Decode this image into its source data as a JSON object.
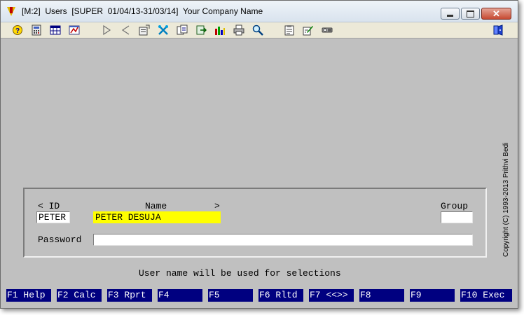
{
  "window": {
    "title": "[M:2]  Users  [SUPER  01/04/13-31/03/14]  Your Company Name",
    "app_icon": "yellow-red-v-logo"
  },
  "toolbar": {
    "icons": [
      "help-icon",
      "calculator-icon",
      "table-icon",
      "report-icon",
      "next-icon",
      "previous-icon",
      "properties-icon",
      "tools-icon",
      "copy-icon",
      "export-icon",
      "chart-icon",
      "print-icon",
      "zoom-icon",
      "clipboard-icon",
      "edit-icon",
      "settings-icon",
      "exit-icon"
    ]
  },
  "side_text": "Copyright (C) 1993-2013  Prithvi Bedi",
  "form": {
    "id_label": "< ID",
    "name_label": "Name",
    "name_arrow": ">",
    "group_label": "Group",
    "id_value": "PETER",
    "name_value": "PETER DESUJA",
    "group_value": "",
    "password_label": "Password",
    "password_value": ""
  },
  "status_message": "User name will be used for selections",
  "function_keys": [
    "F1 Help",
    "F2 Calc",
    "F3 Rprt",
    "F4",
    "F5",
    "F6 Rltd",
    "F7 <<>>",
    "F8",
    "F9",
    "F10 Exec"
  ],
  "colors": {
    "client_bg": "#c0c0c0",
    "fkey_bg": "#000080",
    "highlight": "#ffff00"
  }
}
